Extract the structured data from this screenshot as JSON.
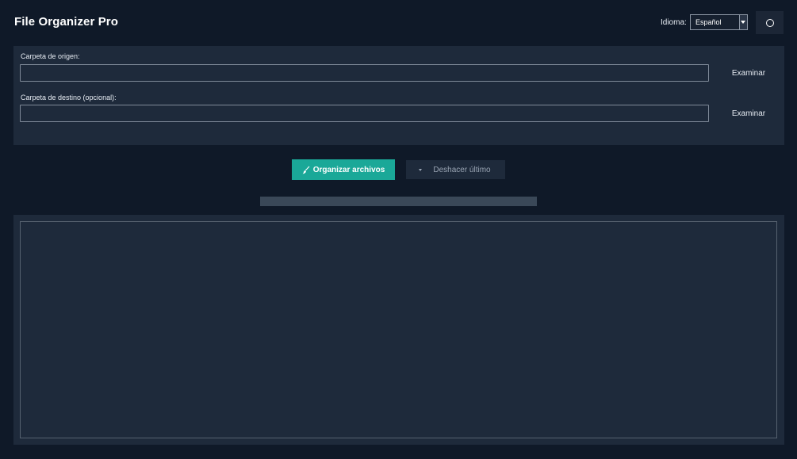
{
  "app": {
    "title": "File Organizer Pro"
  },
  "header": {
    "language_label": "Idioma:",
    "language_value": "Español",
    "theme_icon": "circle-icon"
  },
  "source": {
    "label": "Carpeta de origen:",
    "value": "",
    "browse_label": "Examinar"
  },
  "destination": {
    "label": "Carpeta de destino (opcional):",
    "value": "",
    "browse_label": "Examinar"
  },
  "actions": {
    "organize_label": "Organizar archivos",
    "organize_icon": "broom-icon",
    "undo_label": "Deshacer último",
    "undo_icon": "undo-icon"
  },
  "progress": {
    "value": 0
  },
  "log": {
    "content": ""
  },
  "colors": {
    "accent": "#1aa898",
    "background": "#0f1928",
    "panel": "#1e2a3b"
  }
}
